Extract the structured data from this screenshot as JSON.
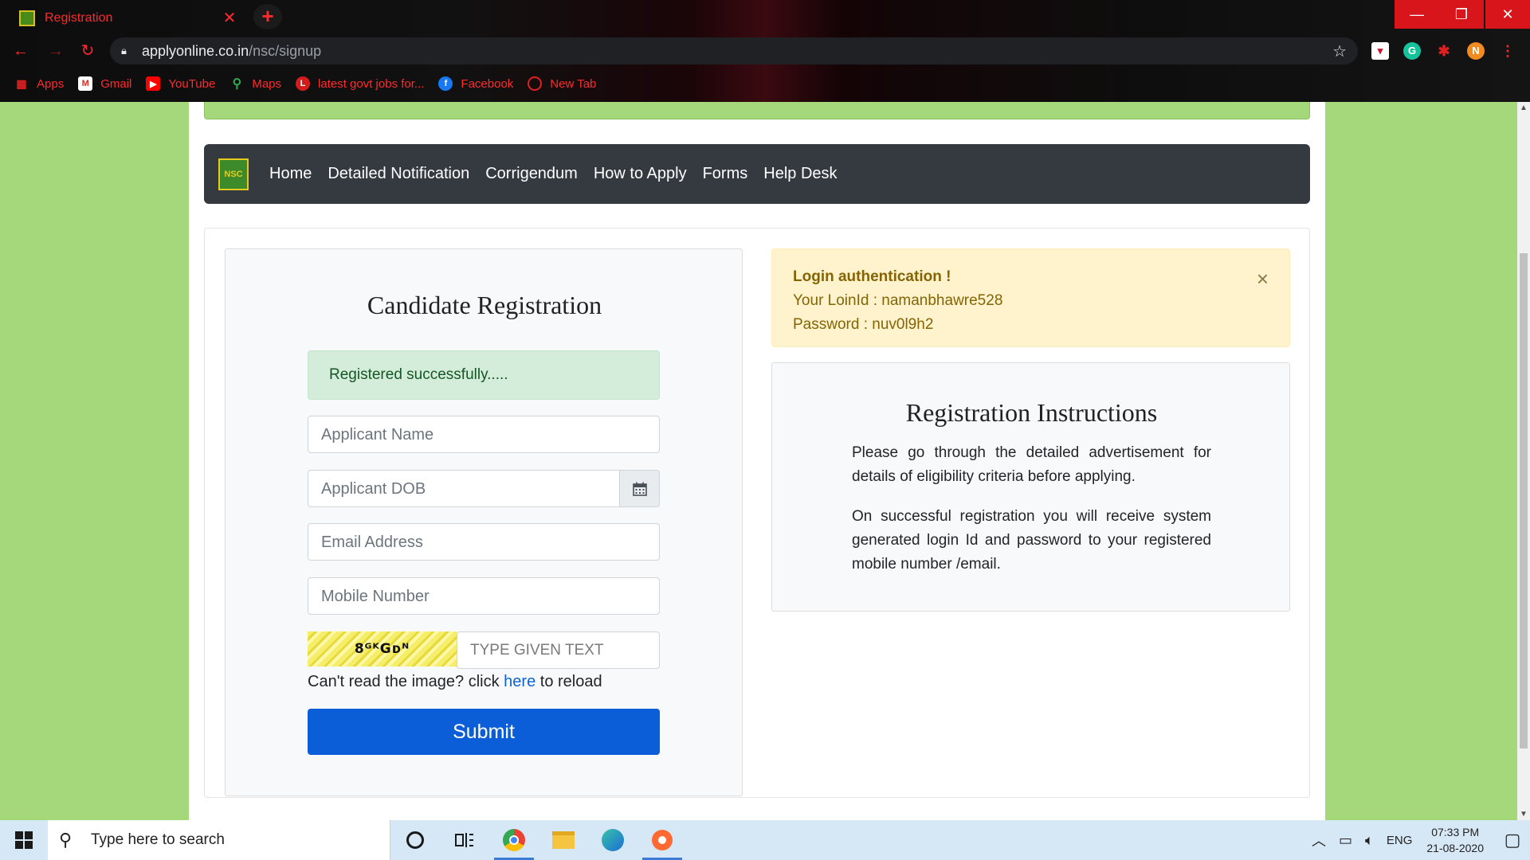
{
  "browser": {
    "tab_title": "Registration",
    "url_domain": "applyonline.co.in",
    "url_path": "/nsc/signup",
    "profile_initial": "N",
    "bookmarks": [
      "Apps",
      "Gmail",
      "YouTube",
      "Maps",
      "latest govt jobs for...",
      "Facebook",
      "New Tab"
    ]
  },
  "navbar": {
    "links": [
      "Home",
      "Detailed Notification",
      "Corrigendum",
      "How to Apply",
      "Forms",
      "Help Desk"
    ]
  },
  "registration": {
    "heading": "Candidate Registration",
    "success_message": "Registered successfully.....",
    "name_placeholder": "Applicant Name",
    "dob_placeholder": "Applicant DOB",
    "email_placeholder": "Email Address",
    "mobile_placeholder": "Mobile Number",
    "captcha_text": "8ᴳᴷGᴅᴺ",
    "captcha_placeholder": "TYPE GIVEN TEXT",
    "reload_prefix": "Can't read the image? click ",
    "reload_link": "here",
    "reload_suffix": " to reload",
    "submit_label": "Submit"
  },
  "login_alert": {
    "title": "Login authentication !",
    "login_line": "Your LoinId : namanbhawre528",
    "password_line": "Password :  nuv0l9h2",
    "close_symbol": "×"
  },
  "instructions": {
    "heading": "Registration Instructions",
    "paragraph1": "Please go through the detailed advertisement for details of eligibility criteria before applying.",
    "paragraph2": "On successful registration you will receive system generated login Id and password to your registered mobile number /email."
  },
  "taskbar": {
    "search_placeholder": "Type here to search",
    "language": "ENG",
    "time": "07:33 PM",
    "date": "21-08-2020"
  },
  "colors": {
    "page_background": "#a4d87a",
    "navbar": "#343a40",
    "submit": "#0b5ed7",
    "success_bg": "#d4edda",
    "warning_bg": "#fff3cd"
  }
}
